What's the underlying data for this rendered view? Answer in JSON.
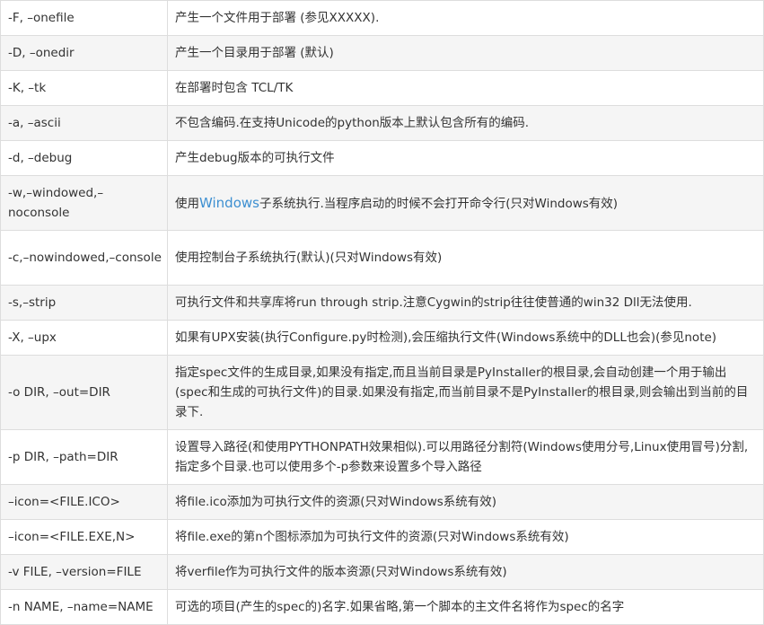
{
  "options_table": {
    "rows": [
      {
        "option": "-F, –onefile",
        "description": "产生一个文件用于部署 (参见XXXXX)."
      },
      {
        "option": "-D, –onedir",
        "description": "产生一个目录用于部署 (默认)"
      },
      {
        "option": "-K, –tk",
        "description": "在部署时包含 TCL/TK"
      },
      {
        "option": "-a, –ascii",
        "description": "不包含编码.在支持Unicode的python版本上默认包含所有的编码."
      },
      {
        "option": "-d, –debug",
        "description": "产生debug版本的可执行文件"
      },
      {
        "option": "-w,–windowed,–noconsole",
        "description_pre": "使用",
        "description_link": "Windows",
        "description_post": "子系统执行.当程序启动的时候不会打开命令行(只对Windows有效)"
      },
      {
        "option": "-c,–nowindowed,–console",
        "description": "使用控制台子系统执行(默认)(只对Windows有效)"
      },
      {
        "option": "-s,–strip",
        "description": "可执行文件和共享库将run through strip.注意Cygwin的strip往往使普通的win32 Dll无法使用."
      },
      {
        "option": "-X, –upx",
        "description": "如果有UPX安装(执行Configure.py时检测),会压缩执行文件(Windows系统中的DLL也会)(参见note)"
      },
      {
        "option": "-o DIR, –out=DIR",
        "description": "指定spec文件的生成目录,如果没有指定,而且当前目录是PyInstaller的根目录,会自动创建一个用于输出(spec和生成的可执行文件)的目录.如果没有指定,而当前目录不是PyInstaller的根目录,则会输出到当前的目录下."
      },
      {
        "option": "-p DIR, –path=DIR",
        "description": "设置导入路径(和使用PYTHONPATH效果相似).可以用路径分割符(Windows使用分号,Linux使用冒号)分割,指定多个目录.也可以使用多个-p参数来设置多个导入路径"
      },
      {
        "option": "–icon=<FILE.ICO>",
        "description": "将file.ico添加为可执行文件的资源(只对Windows系统有效)"
      },
      {
        "option": "–icon=<FILE.EXE,N>",
        "description": "将file.exe的第n个图标添加为可执行文件的资源(只对Windows系统有效)"
      },
      {
        "option": "-v FILE, –version=FILE",
        "description": "将verfile作为可执行文件的版本资源(只对Windows系统有效)"
      },
      {
        "option": "-n NAME, –name=NAME",
        "description": "可选的项目(产生的spec的)名字.如果省略,第一个脚本的主文件名将作为spec的名字"
      }
    ]
  },
  "colors": {
    "link": "#3d8fd1",
    "border": "#dddddd",
    "stripe": "#f5f5f5",
    "text": "#333333"
  }
}
